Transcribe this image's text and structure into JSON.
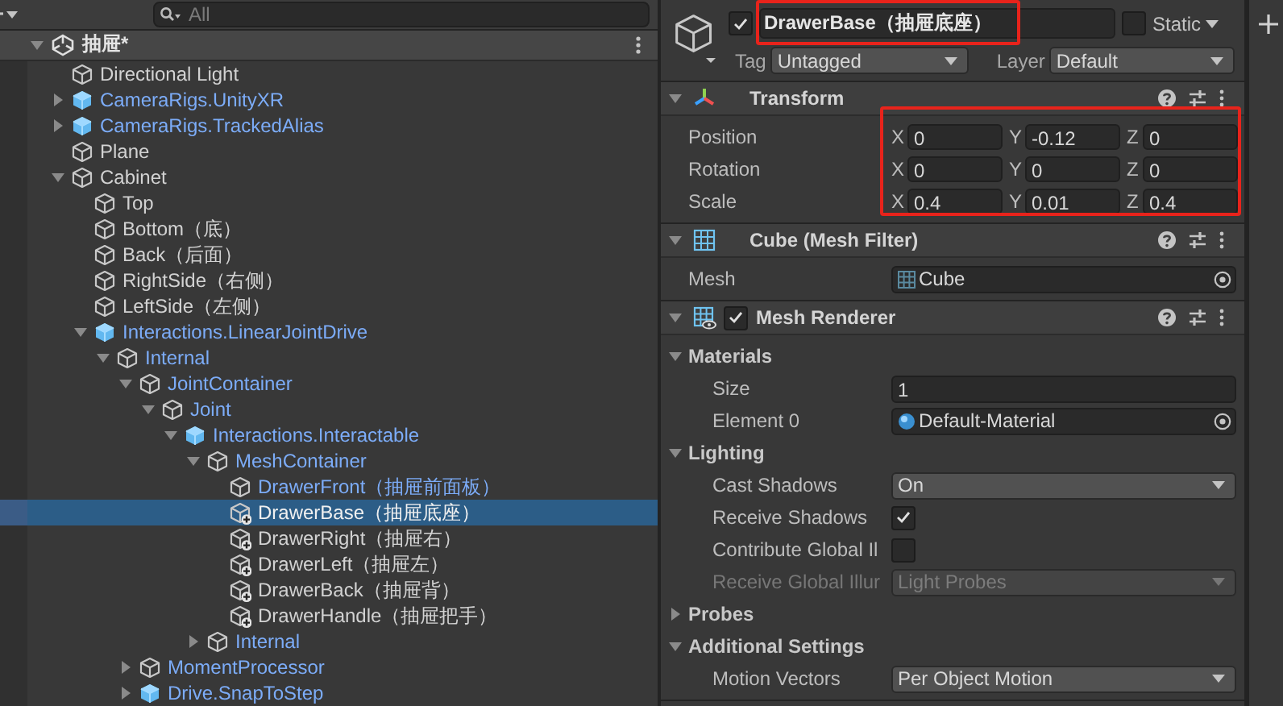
{
  "hierarchy": {
    "search": {
      "placeholder": "All"
    },
    "scene": {
      "name": "抽屉*",
      "expanded": true
    },
    "items": [
      {
        "name": "Directional Light",
        "kind": "object",
        "prefab": false,
        "selected": false
      },
      {
        "name": "CameraRigs.UnityXR",
        "kind": "prefab",
        "prefab": true,
        "expanded": false,
        "selected": false
      },
      {
        "name": "CameraRigs.TrackedAlias",
        "kind": "prefab",
        "prefab": true,
        "expanded": false,
        "selected": false
      },
      {
        "name": "Plane",
        "kind": "object",
        "prefab": false,
        "selected": false
      },
      {
        "name": "Cabinet",
        "kind": "object",
        "prefab": false,
        "expanded": true,
        "selected": false,
        "children": [
          {
            "name": "Top",
            "kind": "object",
            "prefab": false,
            "selected": false
          },
          {
            "name": "Bottom（底）",
            "kind": "object",
            "prefab": false,
            "selected": false
          },
          {
            "name": "Back（后面）",
            "kind": "object",
            "prefab": false,
            "selected": false
          },
          {
            "name": "RightSide（右侧）",
            "kind": "object",
            "prefab": false,
            "selected": false
          },
          {
            "name": "LeftSide（左侧）",
            "kind": "object",
            "prefab": false,
            "selected": false
          },
          {
            "name": "Interactions.LinearJointDrive",
            "kind": "prefab",
            "prefab": true,
            "expanded": true,
            "selected": false,
            "children": [
              {
                "name": "Internal",
                "kind": "object",
                "prefab": true,
                "expanded": true,
                "selected": false,
                "children": [
                  {
                    "name": "JointContainer",
                    "kind": "object",
                    "prefab": true,
                    "expanded": true,
                    "selected": false,
                    "children": [
                      {
                        "name": "Joint",
                        "kind": "object",
                        "prefab": true,
                        "expanded": true,
                        "selected": false,
                        "children": [
                          {
                            "name": "Interactions.Interactable",
                            "kind": "prefab",
                            "prefab": true,
                            "expanded": true,
                            "selected": false,
                            "children": [
                              {
                                "name": "MeshContainer",
                                "kind": "object",
                                "prefab": true,
                                "expanded": true,
                                "selected": false,
                                "children": [
                                  {
                                    "name": "DrawerFront（抽屉前面板）",
                                    "kind": "object",
                                    "prefab": true,
                                    "selected": false
                                  },
                                  {
                                    "name": "DrawerBase（抽屉底座）",
                                    "kind": "added",
                                    "prefab": false,
                                    "selected": true
                                  },
                                  {
                                    "name": "DrawerRight（抽屉右）",
                                    "kind": "added",
                                    "prefab": false,
                                    "selected": false
                                  },
                                  {
                                    "name": "DrawerLeft（抽屉左）",
                                    "kind": "added",
                                    "prefab": false,
                                    "selected": false
                                  },
                                  {
                                    "name": "DrawerBack（抽屉背）",
                                    "kind": "added",
                                    "prefab": false,
                                    "selected": false
                                  },
                                  {
                                    "name": "DrawerHandle（抽屉把手）",
                                    "kind": "added",
                                    "prefab": false,
                                    "selected": false
                                  }
                                ]
                              },
                              {
                                "name": "Internal",
                                "kind": "object",
                                "prefab": true,
                                "expanded": false,
                                "selected": false
                              }
                            ]
                          }
                        ]
                      }
                    ]
                  },
                  {
                    "name": "MomentProcessor",
                    "kind": "object",
                    "prefab": true,
                    "expanded": false,
                    "selected": false
                  },
                  {
                    "name": "Drive.SnapToStep",
                    "kind": "prefab",
                    "prefab": true,
                    "expanded": false,
                    "selected": false
                  }
                ]
              }
            ]
          }
        ]
      }
    ]
  },
  "inspector": {
    "active": true,
    "name": "DrawerBase（抽屉底座）",
    "name_highlighted": true,
    "static": false,
    "static_label": "Static",
    "tag_label": "Tag",
    "tag": "Untagged",
    "layer_label": "Layer",
    "layer": "Default",
    "components": [
      {
        "kind": "transform",
        "title": "Transform",
        "expanded": true,
        "highlighted": true,
        "rows": [
          {
            "label": "Position",
            "values": [
              {
                "axis": "X",
                "value": "0"
              },
              {
                "axis": "Y",
                "value": "-0.12"
              },
              {
                "axis": "Z",
                "value": "0"
              }
            ]
          },
          {
            "label": "Rotation",
            "values": [
              {
                "axis": "X",
                "value": "0"
              },
              {
                "axis": "Y",
                "value": "0"
              },
              {
                "axis": "Z",
                "value": "0"
              }
            ]
          },
          {
            "label": "Scale",
            "values": [
              {
                "axis": "X",
                "value": "0.4"
              },
              {
                "axis": "Y",
                "value": "0.01"
              },
              {
                "axis": "Z",
                "value": "0.4"
              }
            ]
          }
        ]
      },
      {
        "kind": "mesh_filter",
        "title": "Cube (Mesh Filter)",
        "expanded": true,
        "properties": [
          {
            "kind": "object",
            "label": "Mesh",
            "value": "Cube"
          }
        ]
      },
      {
        "kind": "mesh_renderer",
        "title": "Mesh Renderer",
        "expanded": true,
        "enabled": true,
        "properties": [
          {
            "kind": "foldout",
            "label": "Materials",
            "expanded": true,
            "children": [
              {
                "kind": "text",
                "label": "Size",
                "value": "1"
              },
              {
                "kind": "object",
                "label": "Element 0",
                "value": "Default-Material"
              }
            ]
          },
          {
            "kind": "foldout",
            "label": "Lighting",
            "expanded": true,
            "children": [
              {
                "kind": "dropdown",
                "label": "Cast Shadows",
                "value": "On",
                "disabled": false
              },
              {
                "kind": "checkbox",
                "label": "Receive Shadows",
                "checked": true
              },
              {
                "kind": "checkbox",
                "label": "Contribute Global Il",
                "checked": false
              },
              {
                "kind": "dropdown",
                "label": "Receive Global Illur",
                "value": "Light Probes",
                "disabled": true
              }
            ]
          },
          {
            "kind": "foldout",
            "label": "Probes",
            "expanded": false
          },
          {
            "kind": "foldout",
            "label": "Additional Settings",
            "expanded": true,
            "children": [
              {
                "kind": "dropdown",
                "label": "Motion Vectors",
                "value": "Per Object Motion",
                "disabled": false
              }
            ]
          }
        ]
      }
    ]
  }
}
